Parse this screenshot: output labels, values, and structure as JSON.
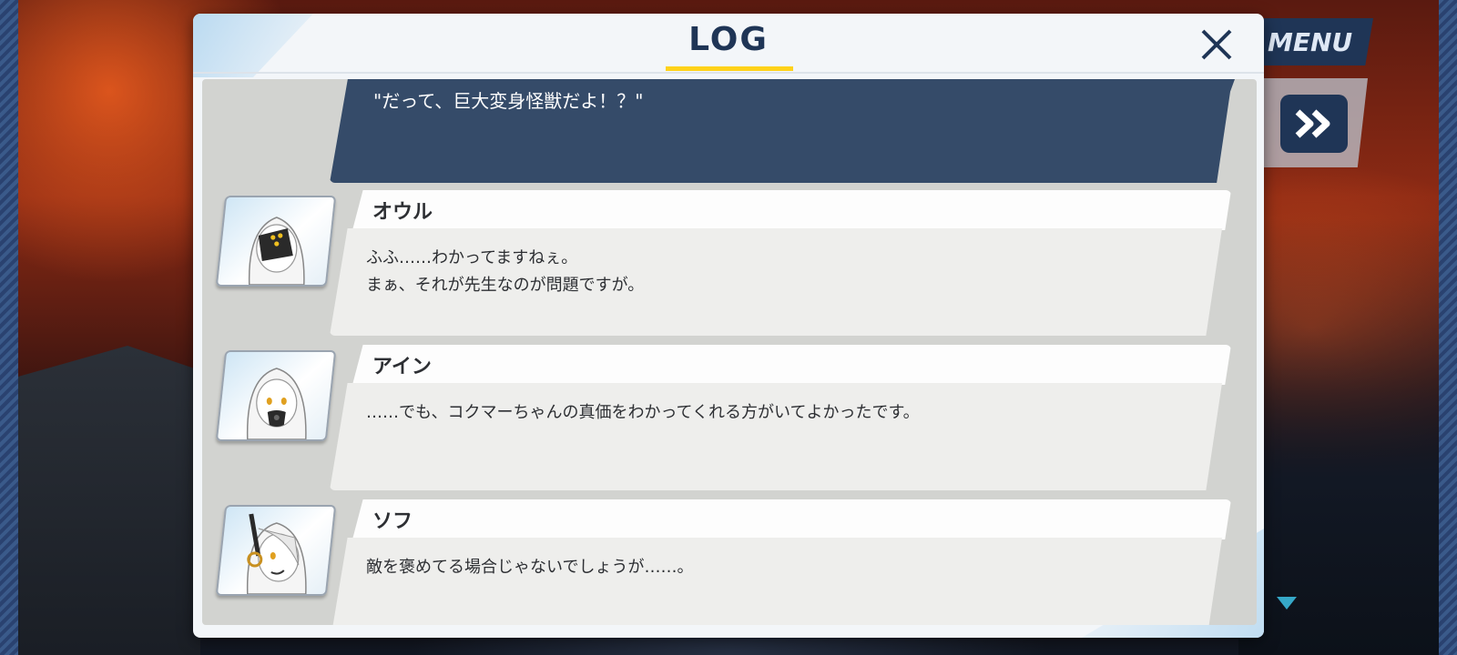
{
  "hud": {
    "menu_label": "MENU",
    "fast_forward_icon": "double-chevron-right-icon",
    "scroll_indicator_icon": "triangle-down-icon"
  },
  "log": {
    "title": "LOG",
    "close_icon": "close-icon",
    "entries": [
      {
        "speaker": "",
        "lines": [
          "\"だって、巨大変身怪獣だよ！？\""
        ],
        "style": "selected"
      },
      {
        "speaker": "オウル",
        "lines": [
          "ふふ……わかってますねぇ。",
          "まぁ、それが先生なのが問題ですが。"
        ]
      },
      {
        "speaker": "アイン",
        "lines": [
          "……でも、コクマーちゃんの真価をわかってくれる方がいてよかったです。"
        ]
      },
      {
        "speaker": "ソフ",
        "lines": [
          "敵を褒めてる場合じゃないでしょうが……。"
        ]
      }
    ]
  },
  "colors": {
    "navy": "#1f3556",
    "selected_entry": "#354b69",
    "accent_yellow": "#ffd21a",
    "scroll_arrow": "#36a8c8"
  }
}
